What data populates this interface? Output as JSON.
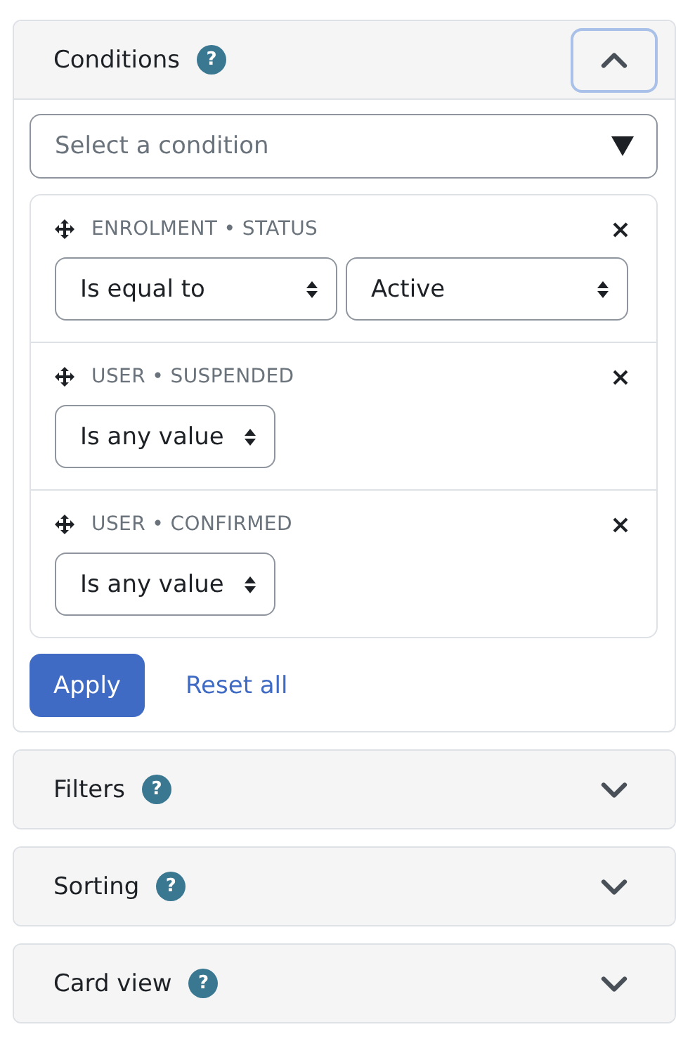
{
  "sections": [
    {
      "title": "Conditions",
      "help": "?",
      "expanded": true,
      "focused": true,
      "select": {
        "placeholder": "Select a condition"
      },
      "conditions": [
        {
          "heading": "ENROLMENT • STATUS",
          "operator": "Is equal to",
          "value": "Active"
        },
        {
          "heading": "USER • SUSPENDED",
          "operator": "Is any value"
        },
        {
          "heading": "USER • CONFIRMED",
          "operator": "Is any value"
        }
      ],
      "buttons": {
        "apply": "Apply",
        "reset": "Reset all"
      }
    },
    {
      "title": "Filters",
      "help": "?",
      "expanded": false,
      "focused": false
    },
    {
      "title": "Sorting",
      "help": "?",
      "expanded": false,
      "focused": false
    },
    {
      "title": "Card view",
      "help": "?",
      "expanded": false,
      "focused": false
    }
  ]
}
